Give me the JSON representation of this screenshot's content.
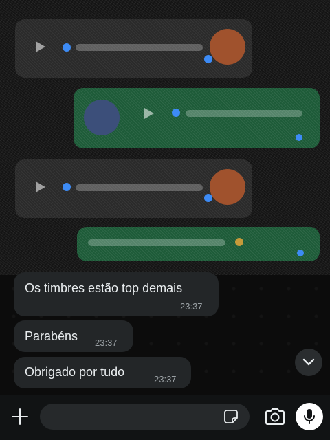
{
  "messages": [
    {
      "text": "Os timbres estão top demais",
      "time": "23:37"
    },
    {
      "text": "Parabéns",
      "time": "23:37"
    },
    {
      "text": "Obrigado por tudo",
      "time": "23:37"
    }
  ],
  "input": {
    "placeholder": ""
  },
  "icons": {
    "attach": "plus-icon",
    "sticker": "sticker-icon",
    "camera": "camera-icon",
    "mic": "microphone-icon",
    "scroll": "chevron-down-icon"
  },
  "colors": {
    "incoming_bubble": "#232628",
    "outgoing_bubble": "#1d5b38",
    "background": "#0b0b0b",
    "mic_button": "#ffffff"
  }
}
